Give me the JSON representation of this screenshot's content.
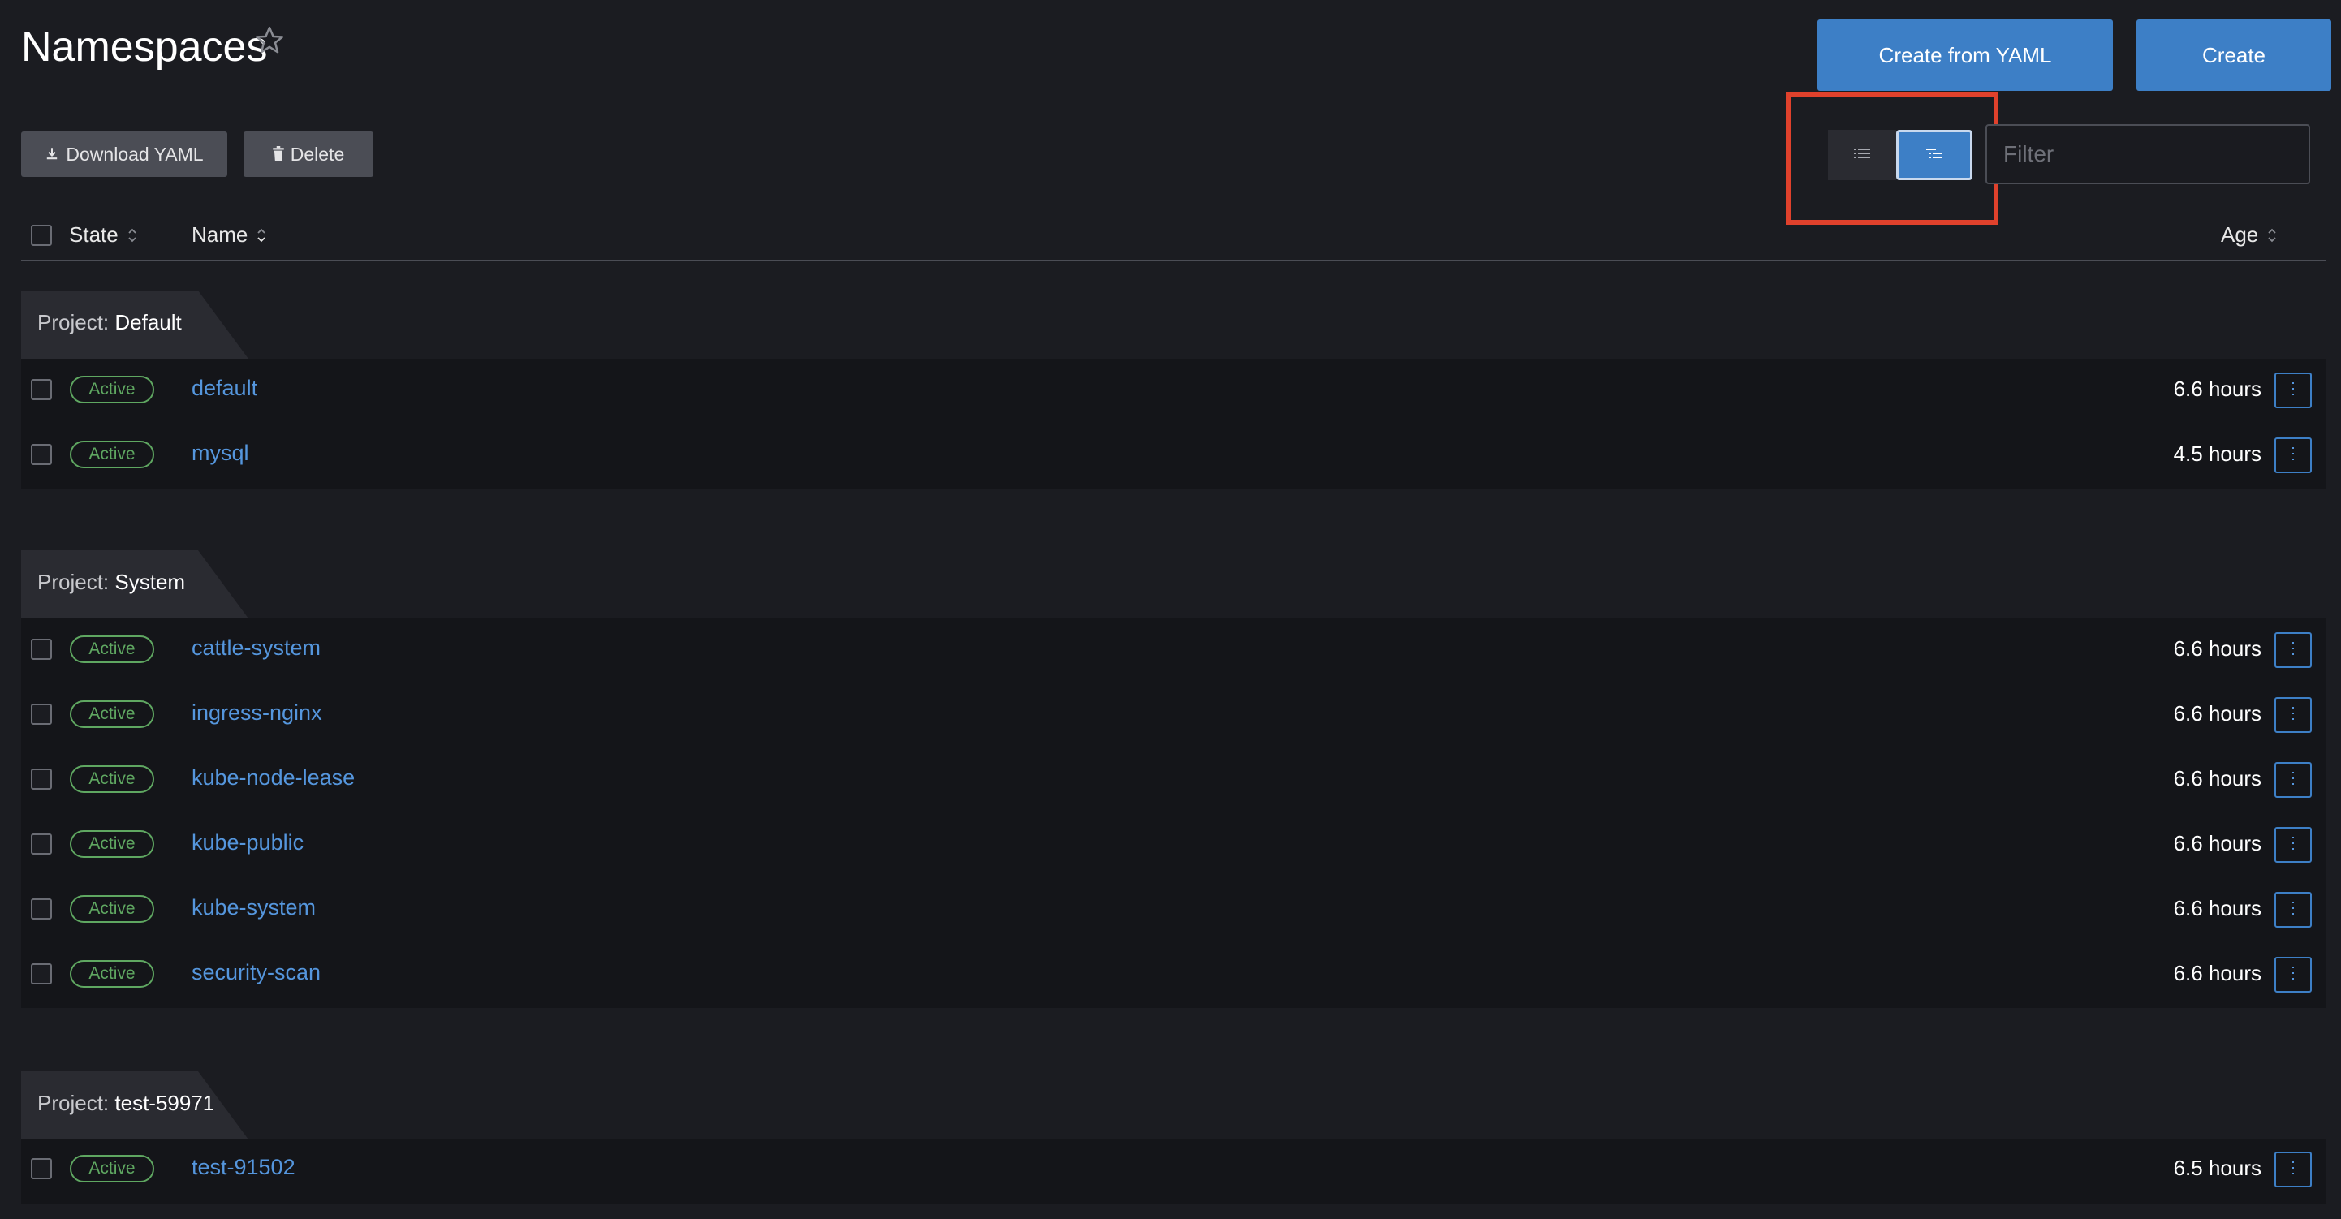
{
  "header": {
    "title": "Namespaces",
    "create_from_yaml_label": "Create from YAML",
    "create_label": "Create"
  },
  "toolbar": {
    "download_yaml_label": "Download YAML",
    "delete_label": "Delete",
    "filter_placeholder": "Filter",
    "view_modes": [
      "flat-list-icon",
      "grouped-list-icon"
    ],
    "active_view": "grouped",
    "highlight_color": "#e0412c"
  },
  "table": {
    "columns": {
      "state": "State",
      "name": "Name",
      "age": "Age"
    }
  },
  "groups": [
    {
      "prefix": "Project:",
      "name": "Default",
      "rows": [
        {
          "state": "Active",
          "name": "default",
          "age": "6.6 hours"
        },
        {
          "state": "Active",
          "name": "mysql",
          "age": "4.5 hours"
        }
      ]
    },
    {
      "prefix": "Project:",
      "name": "System",
      "rows": [
        {
          "state": "Active",
          "name": "cattle-system",
          "age": "6.6 hours"
        },
        {
          "state": "Active",
          "name": "ingress-nginx",
          "age": "6.6 hours"
        },
        {
          "state": "Active",
          "name": "kube-node-lease",
          "age": "6.6 hours"
        },
        {
          "state": "Active",
          "name": "kube-public",
          "age": "6.6 hours"
        },
        {
          "state": "Active",
          "name": "kube-system",
          "age": "6.6 hours"
        },
        {
          "state": "Active",
          "name": "security-scan",
          "age": "6.6 hours"
        }
      ]
    },
    {
      "prefix": "Project:",
      "name": "test-59971",
      "rows": [
        {
          "state": "Active",
          "name": "test-91502",
          "age": "6.5 hours"
        }
      ]
    }
  ],
  "colors": {
    "background": "#1b1c21",
    "primary": "#3d7fc6",
    "link": "#5596dd",
    "active_badge": "#5fa761"
  }
}
